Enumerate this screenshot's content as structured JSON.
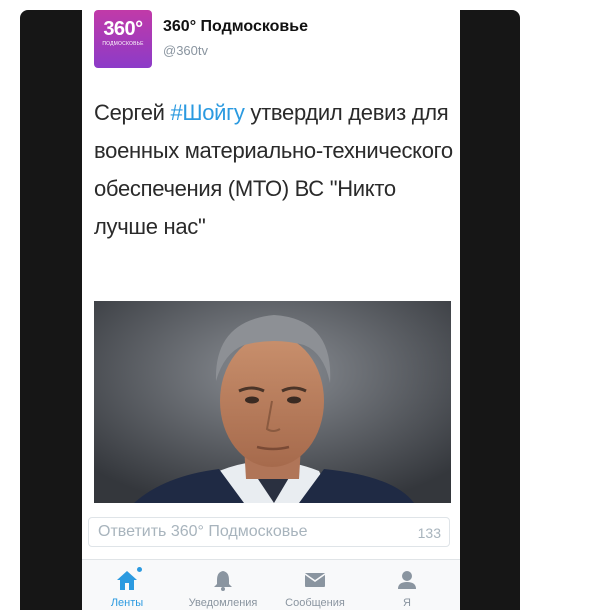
{
  "tweet": {
    "avatar": {
      "number": "360°",
      "subtitle": "подмосковье"
    },
    "author_name": "360° Подмосковье",
    "author_handle": "@360tv",
    "text_before": "Сергей ",
    "hashtag": "#Шойгу",
    "text_after": " утвердил девиз для военных материально-технического обеспечения (МТО) ВС \"Никто лучше нас\""
  },
  "reply": {
    "placeholder": "Ответить 360° Подмосковье",
    "char_count": "133"
  },
  "tabs": [
    {
      "label": "Ленты",
      "icon": "home-icon",
      "active": true
    },
    {
      "label": "Уведомления",
      "icon": "bell-icon",
      "active": false
    },
    {
      "label": "Сообщения",
      "icon": "envelope-icon",
      "active": false
    },
    {
      "label": "Я",
      "icon": "person-icon",
      "active": false
    }
  ],
  "colors": {
    "accent": "#2b9ae0",
    "avatar_top": "#c13aa8",
    "avatar_bottom": "#8c3bc8",
    "muted": "#8a95a0",
    "frame": "#161616"
  }
}
